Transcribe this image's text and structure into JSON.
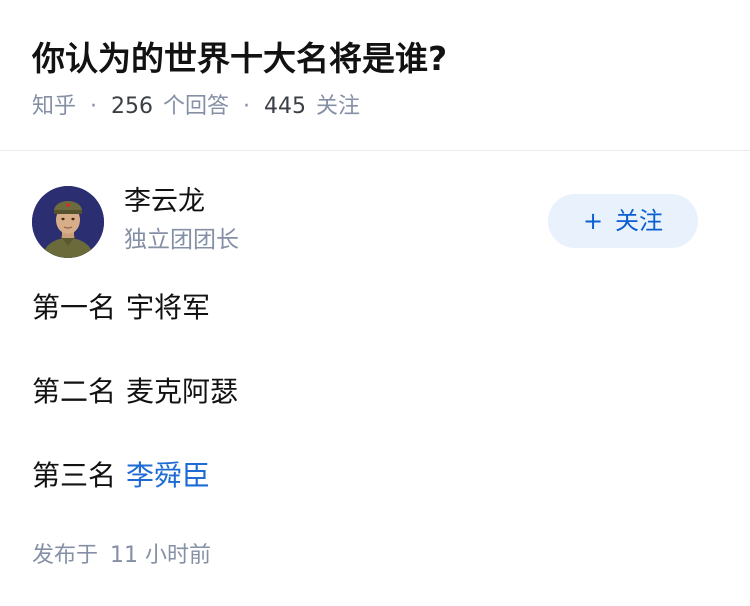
{
  "question": {
    "title": "你认为的世界十大名将是谁?",
    "source": "知乎",
    "answer_count": "256",
    "answer_label": "个回答",
    "follower_count": "445",
    "follower_label": "关注"
  },
  "author": {
    "name": "李云龙",
    "bio": "独立团团长",
    "follow_plus": "+",
    "follow_label": "关注"
  },
  "answer": {
    "items": [
      {
        "rank": "第一名",
        "name": "宇将军",
        "is_link": false
      },
      {
        "rank": "第二名",
        "name": "麦克阿瑟",
        "is_link": false
      },
      {
        "rank": "第三名",
        "name": "李舜臣",
        "is_link": true
      }
    ]
  },
  "footer": {
    "posted_label": "发布于",
    "posted_time": "11 小时前"
  },
  "colors": {
    "accent": "#1e6bd6",
    "button_bg": "#e8f1fc",
    "muted": "#8590a6"
  },
  "icons": {
    "avatar": "soldier-avatar-icon"
  }
}
